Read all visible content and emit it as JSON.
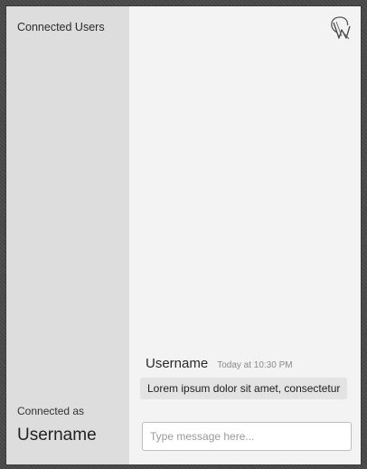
{
  "sidebar": {
    "title": "Connected Users",
    "connected_as_label": "Connected as",
    "username": "Username"
  },
  "header": {
    "logo_icon": "brand-logo-icon"
  },
  "messages": [
    {
      "user": "Username",
      "time": "Today at 10:30 PM",
      "text": "Lorem ipsum dolor sit amet, consectetur"
    }
  ],
  "composer": {
    "placeholder": "Type message here..."
  },
  "colors": {
    "sidebar_bg": "#dddddd",
    "main_bg": "#f3f3f3",
    "message_bubble": "#e3e3e3"
  }
}
